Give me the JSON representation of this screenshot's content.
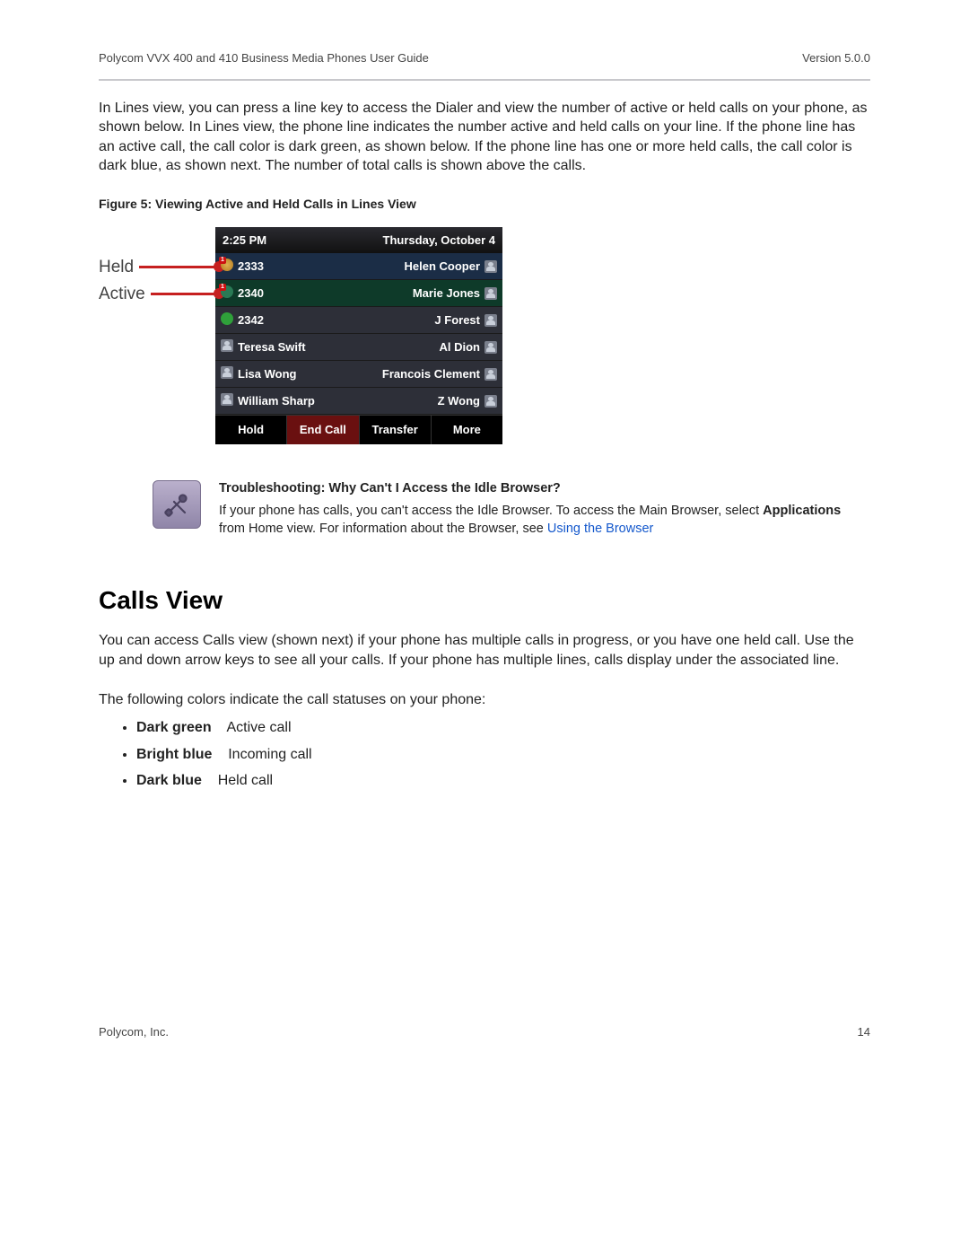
{
  "header": {
    "title": "Polycom VVX 400 and 410 Business Media Phones User Guide",
    "version": "Version 5.0.0"
  },
  "intro_para": "In Lines view, you can press a line key to access the Dialer and view the number of active or held calls on your phone, as shown below. In Lines view, the phone line indicates the number active and held calls on your line. If the phone line has an active call, the call color is dark green, as shown below. If the phone line has one or more held calls, the call color is dark blue, as shown next. The number of total calls is shown above the calls.",
  "figure": {
    "caption": "Figure 5: Viewing Active and Held Calls in Lines View",
    "callouts": {
      "held": "Held",
      "active": "Active"
    },
    "phone": {
      "time": "2:25 PM",
      "date": "Thursday, October 4",
      "rows": [
        {
          "left": "2333",
          "right": "Helen Cooper",
          "state": "held",
          "badge": "1"
        },
        {
          "left": "2340",
          "right": "Marie Jones",
          "state": "active",
          "badge": "1"
        },
        {
          "left": "2342",
          "right": "J Forest",
          "state": "avail"
        },
        {
          "left": "Teresa Swift",
          "right": "Al Dion",
          "state": "person"
        },
        {
          "left": "Lisa Wong",
          "right": "Francois Clement",
          "state": "person"
        },
        {
          "left": "William Sharp",
          "right": "Z Wong",
          "state": "person"
        }
      ],
      "softkeys": [
        "Hold",
        "End Call",
        "Transfer",
        "More"
      ]
    }
  },
  "note": {
    "title": "Troubleshooting: Why Can't I Access the Idle Browser?",
    "body_pre": "If your phone has calls, you can't access the Idle Browser. To access the Main Browser, select ",
    "body_bold": "Applications",
    "body_mid": " from Home view. For information about the Browser, see ",
    "link": "Using the Browser"
  },
  "section": {
    "heading": "Calls View",
    "para1": "You can access Calls view (shown next) if your phone has multiple calls in progress, or you have one held call. Use the up and down arrow keys to see all your calls. If your phone has multiple lines, calls display under the associated line.",
    "para2": "The following colors indicate the call statuses on your phone:",
    "colors": [
      {
        "label": "Dark green",
        "desc": "Active call"
      },
      {
        "label": "Bright blue",
        "desc": "Incoming call"
      },
      {
        "label": "Dark blue",
        "desc": "Held call"
      }
    ]
  },
  "footer": {
    "company": "Polycom, Inc.",
    "page": "14"
  }
}
